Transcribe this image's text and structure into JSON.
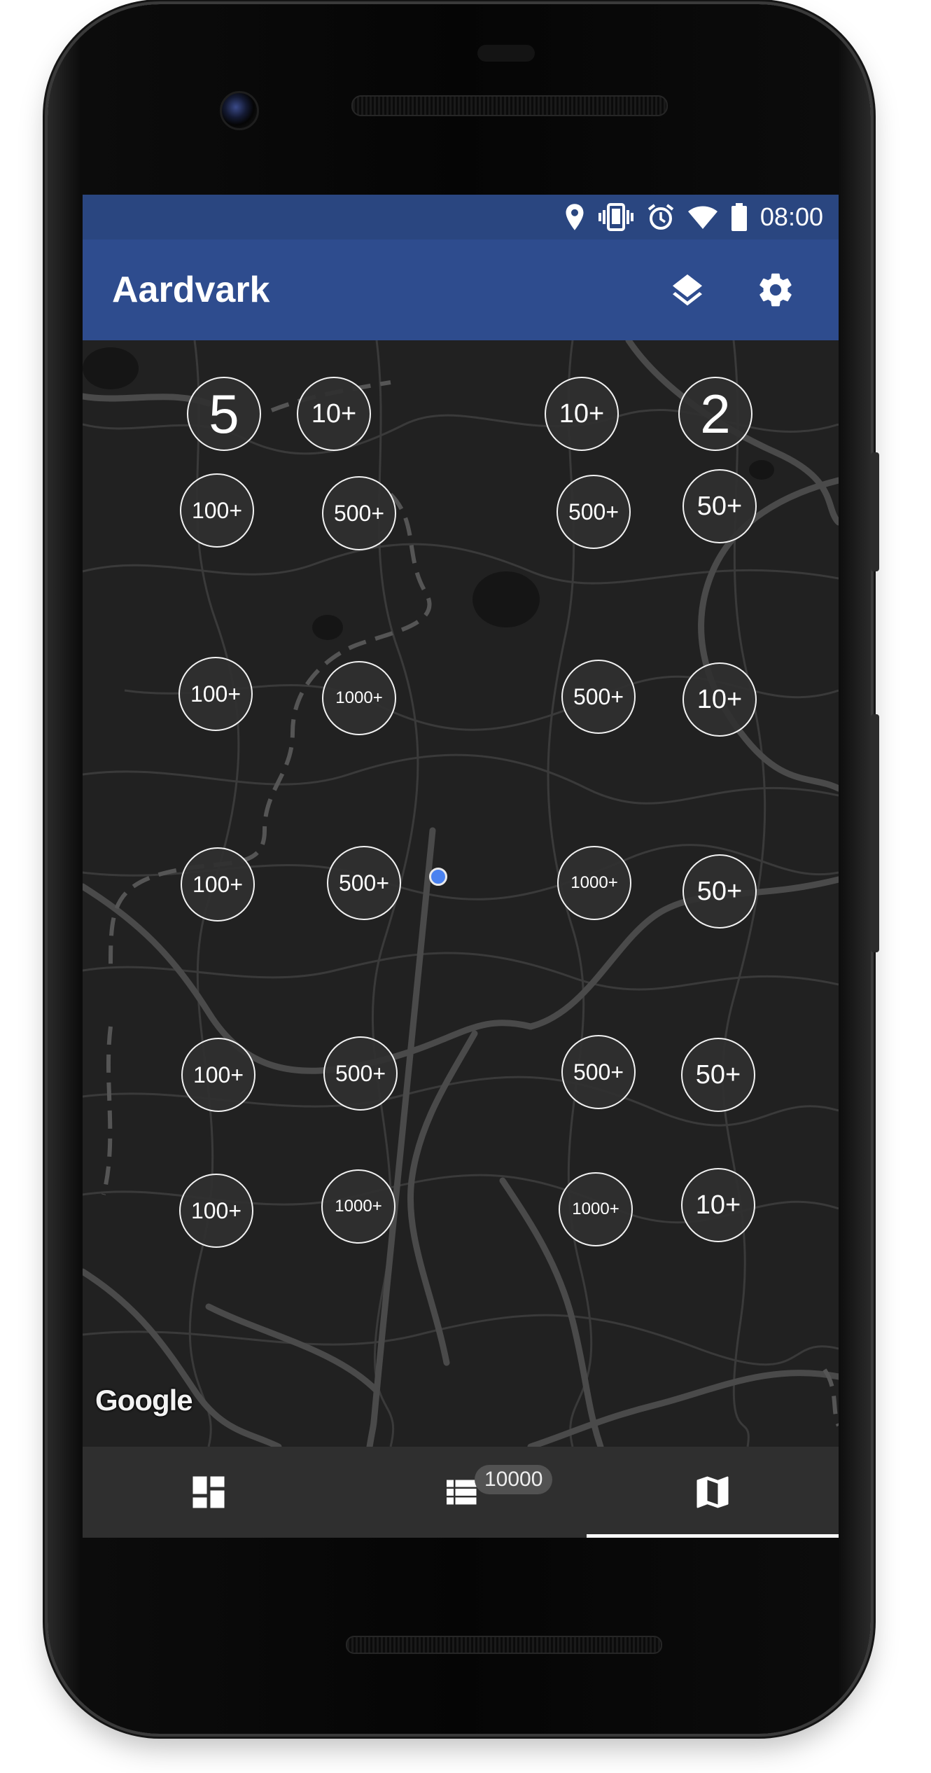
{
  "status_bar": {
    "time": "08:00",
    "icons": [
      "location-icon",
      "vibrate-icon",
      "alarm-icon",
      "wifi-icon",
      "battery-icon"
    ]
  },
  "app_bar": {
    "title": "Aardvark",
    "actions": [
      "layers-icon",
      "settings-icon"
    ]
  },
  "map": {
    "theme": "dark",
    "attribution": "Google",
    "clusters": [
      {
        "label": "5"
      },
      {
        "label": "10+"
      },
      {
        "label": "10+"
      },
      {
        "label": "2"
      },
      {
        "label": "100+"
      },
      {
        "label": "500+"
      },
      {
        "label": "500+"
      },
      {
        "label": "50+"
      },
      {
        "label": "100+"
      },
      {
        "label": "1000+"
      },
      {
        "label": "500+"
      },
      {
        "label": "10+"
      },
      {
        "label": "100+"
      },
      {
        "label": "500+"
      },
      {
        "label": "1000+"
      },
      {
        "label": "50+"
      },
      {
        "label": "100+"
      },
      {
        "label": "500+"
      },
      {
        "label": "500+"
      },
      {
        "label": "50+"
      },
      {
        "label": "100+"
      },
      {
        "label": "1000+"
      },
      {
        "label": "1000+"
      },
      {
        "label": "10+"
      }
    ],
    "my_location_button_icon": "my-location-icon"
  },
  "bottom_nav": {
    "items": [
      {
        "icon": "dashboard-icon",
        "active": false
      },
      {
        "icon": "list-icon",
        "badge": "10000",
        "active": false
      },
      {
        "icon": "map-icon",
        "active": true
      }
    ]
  },
  "colors": {
    "status_bar": "#2a4680",
    "app_bar": "#2e4c8e",
    "fab": "#2e4c8e",
    "map_background": "#212121",
    "roads": "#4a4a4a",
    "location_dot": "#4a82f0",
    "bottom_nav": "#2f2f2f"
  }
}
